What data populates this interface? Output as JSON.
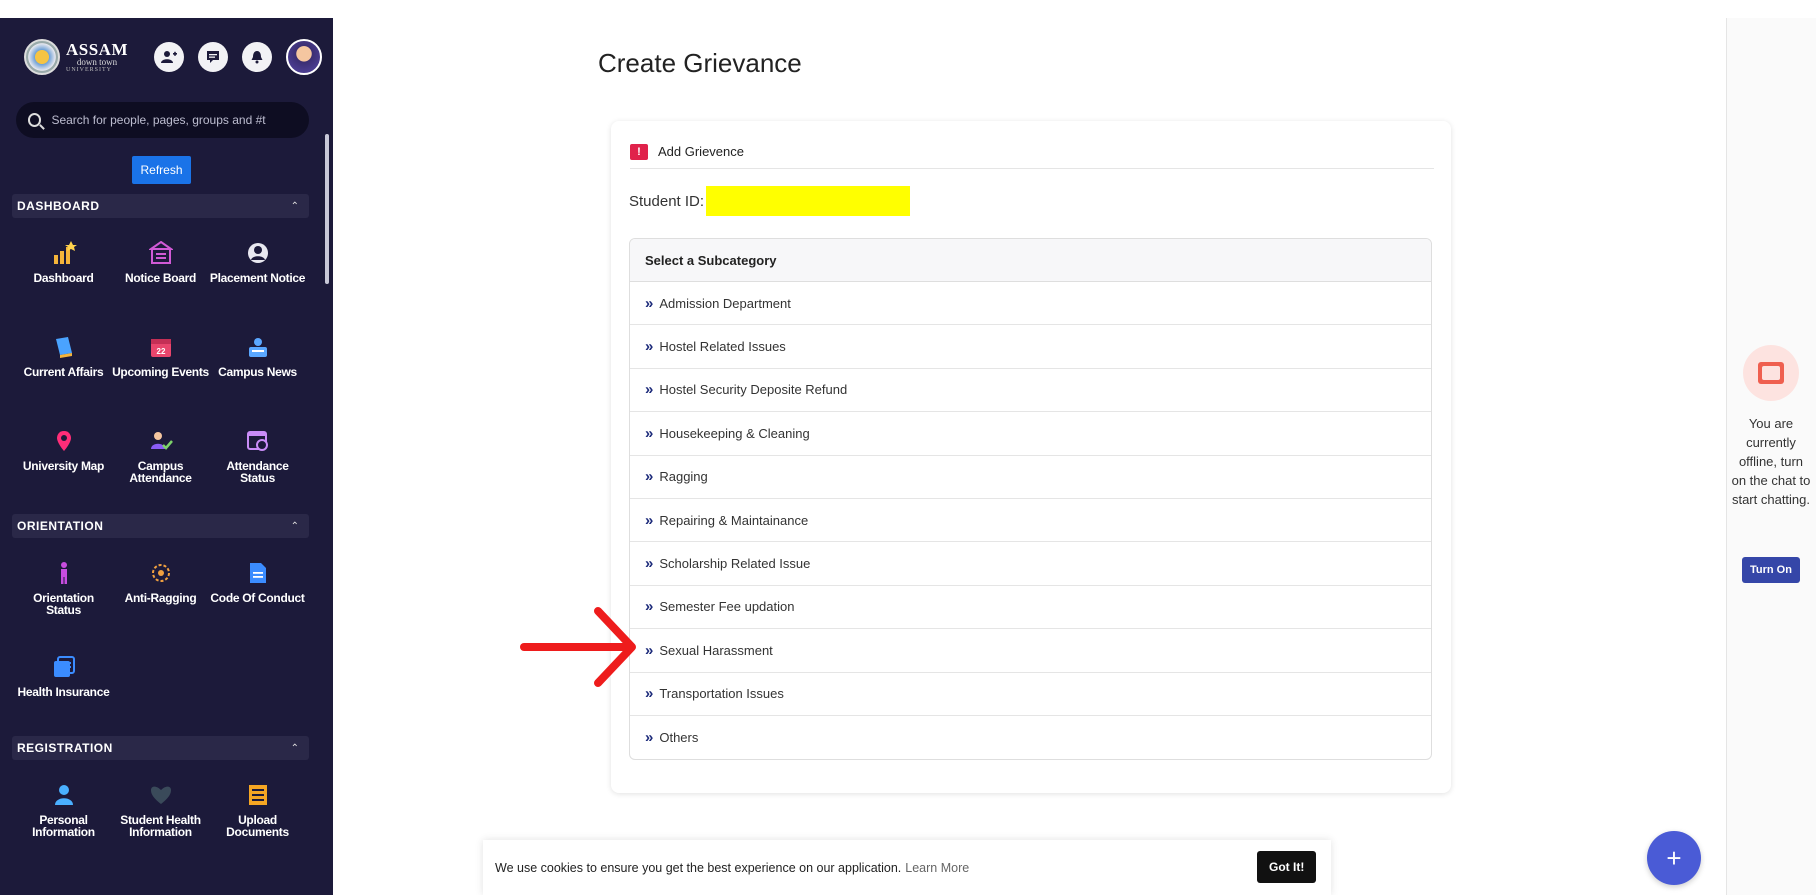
{
  "sidebar": {
    "logo": {
      "line1": "ASSAM",
      "line2": "down town",
      "line3": "UNIVERSITY"
    },
    "search_placeholder": "Search for people, pages, groups and #t",
    "refresh_label": "Refresh",
    "sections": [
      {
        "title": "DASHBOARD",
        "items": [
          {
            "label": "Dashboard",
            "icon": "chart-icon",
            "color": "#f5b43a"
          },
          {
            "label": "Notice Board",
            "icon": "notice-board-icon",
            "color": "#d05ad6"
          },
          {
            "label": "Placement Notice",
            "icon": "placement-icon",
            "color": "#e8e8f0"
          },
          {
            "label": "Current Affairs",
            "icon": "book-icon",
            "color": "#4aa3ff"
          },
          {
            "label": "Upcoming Events",
            "icon": "calendar-icon",
            "color": "#e8456c"
          },
          {
            "label": "Campus News",
            "icon": "news-icon",
            "color": "#5aa7ff"
          },
          {
            "label": "University Map",
            "icon": "map-pin-icon",
            "color": "#ff2d78"
          },
          {
            "label": "Campus Attendance",
            "icon": "user-check-icon",
            "color": "#7dd36a"
          },
          {
            "label": "Attendance Status",
            "icon": "calendar-clock-icon",
            "color": "#c98cf7"
          }
        ]
      },
      {
        "title": "ORIENTATION",
        "items": [
          {
            "label": "Orientation Status",
            "icon": "person-icon",
            "color": "#c84de0"
          },
          {
            "label": "Anti-Ragging",
            "icon": "anti-ragging-icon",
            "color": "#f0a040"
          },
          {
            "label": "Code Of Conduct",
            "icon": "document-icon",
            "color": "#3b8cff"
          },
          {
            "label": "Health Insurance",
            "icon": "insurance-icon",
            "color": "#3b8cff"
          }
        ]
      },
      {
        "title": "REGISTRATION",
        "items": [
          {
            "label": "Personal Information",
            "icon": "personal-info-icon",
            "color": "#4ab0ff"
          },
          {
            "label": "Student Health Information",
            "icon": "heartbeat-icon",
            "color": "#3a4a5a"
          },
          {
            "label": "Upload Documents",
            "icon": "upload-icon",
            "color": "#f5a623"
          }
        ]
      }
    ]
  },
  "main": {
    "title": "Create Grievance",
    "card_title": "Add Grievence",
    "student_id_label": "Student ID:",
    "subcategory_header": "Select a Subcategory",
    "subcategories": [
      "Admission Department",
      "Hostel Related Issues",
      "Hostel Security Deposite Refund",
      "Housekeeping & Cleaning",
      "Ragging",
      "Repairing & Maintainance",
      "Scholarship Related Issue",
      "Semester Fee updation",
      "Sexual Harassment",
      "Transportation Issues",
      "Others"
    ]
  },
  "cookie": {
    "text": "We use cookies to ensure you get the best experience on our application.",
    "learn_more": "Learn More",
    "button": "Got It!"
  },
  "chat": {
    "status_text": "You are currently offline, turn on the chat to start chatting.",
    "button": "Turn On"
  },
  "fab_label": "+"
}
